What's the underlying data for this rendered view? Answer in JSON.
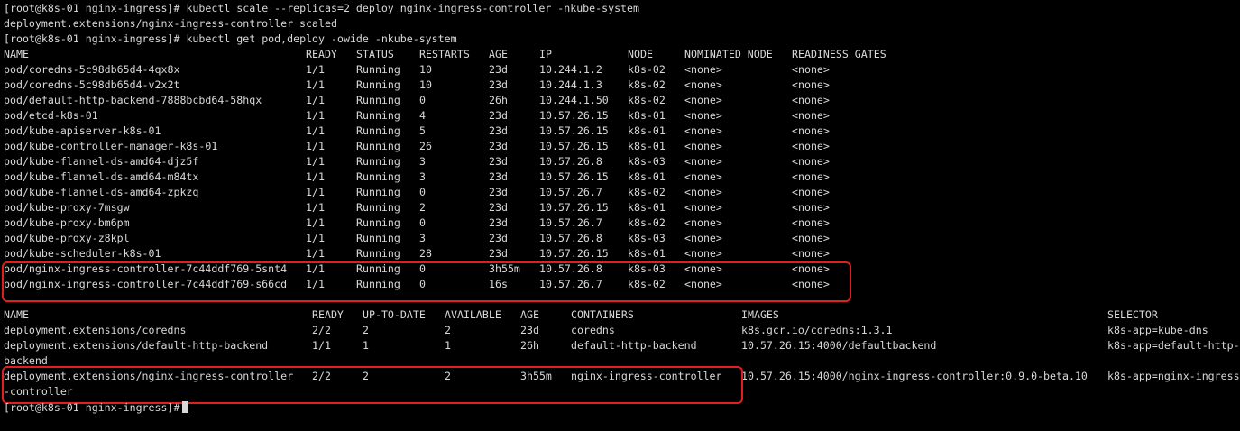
{
  "terminal": {
    "prompt": "[root@k8s-01 nginx-ingress]#",
    "cmd1": "kubectl scale --replicas=2 deploy nginx-ingress-controller -nkube-system",
    "scale_output": "deployment.extensions/nginx-ingress-controller scaled",
    "cmd2": "kubectl get pod,deploy -owide -nkube-system",
    "highlight_color": "#e02020"
  },
  "pods": {
    "headers": [
      "NAME",
      "READY",
      "STATUS",
      "RESTARTS",
      "AGE",
      "IP",
      "NODE",
      "NOMINATED NODE",
      "READINESS GATES"
    ],
    "rows": [
      [
        "pod/coredns-5c98db65d4-4qx8x",
        "1/1",
        "Running",
        "10",
        "23d",
        "10.244.1.2",
        "k8s-02",
        "<none>",
        "<none>"
      ],
      [
        "pod/coredns-5c98db65d4-v2x2t",
        "1/1",
        "Running",
        "10",
        "23d",
        "10.244.1.3",
        "k8s-02",
        "<none>",
        "<none>"
      ],
      [
        "pod/default-http-backend-7888bcbd64-58hqx",
        "1/1",
        "Running",
        "0",
        "26h",
        "10.244.1.50",
        "k8s-02",
        "<none>",
        "<none>"
      ],
      [
        "pod/etcd-k8s-01",
        "1/1",
        "Running",
        "4",
        "23d",
        "10.57.26.15",
        "k8s-01",
        "<none>",
        "<none>"
      ],
      [
        "pod/kube-apiserver-k8s-01",
        "1/1",
        "Running",
        "5",
        "23d",
        "10.57.26.15",
        "k8s-01",
        "<none>",
        "<none>"
      ],
      [
        "pod/kube-controller-manager-k8s-01",
        "1/1",
        "Running",
        "26",
        "23d",
        "10.57.26.15",
        "k8s-01",
        "<none>",
        "<none>"
      ],
      [
        "pod/kube-flannel-ds-amd64-djz5f",
        "1/1",
        "Running",
        "3",
        "23d",
        "10.57.26.8",
        "k8s-03",
        "<none>",
        "<none>"
      ],
      [
        "pod/kube-flannel-ds-amd64-m84tx",
        "1/1",
        "Running",
        "3",
        "23d",
        "10.57.26.15",
        "k8s-01",
        "<none>",
        "<none>"
      ],
      [
        "pod/kube-flannel-ds-amd64-zpkzq",
        "1/1",
        "Running",
        "0",
        "23d",
        "10.57.26.7",
        "k8s-02",
        "<none>",
        "<none>"
      ],
      [
        "pod/kube-proxy-7msgw",
        "1/1",
        "Running",
        "2",
        "23d",
        "10.57.26.15",
        "k8s-01",
        "<none>",
        "<none>"
      ],
      [
        "pod/kube-proxy-bm6pm",
        "1/1",
        "Running",
        "0",
        "23d",
        "10.57.26.7",
        "k8s-02",
        "<none>",
        "<none>"
      ],
      [
        "pod/kube-proxy-z8kpl",
        "1/1",
        "Running",
        "3",
        "23d",
        "10.57.26.8",
        "k8s-03",
        "<none>",
        "<none>"
      ],
      [
        "pod/kube-scheduler-k8s-01",
        "1/1",
        "Running",
        "28",
        "23d",
        "10.57.26.15",
        "k8s-01",
        "<none>",
        "<none>"
      ],
      [
        "pod/nginx-ingress-controller-7c44ddf769-5snt4",
        "1/1",
        "Running",
        "0",
        "3h55m",
        "10.57.26.8",
        "k8s-03",
        "<none>",
        "<none>"
      ],
      [
        "pod/nginx-ingress-controller-7c44ddf769-s66cd",
        "1/1",
        "Running",
        "0",
        "16s",
        "10.57.26.7",
        "k8s-02",
        "<none>",
        "<none>"
      ]
    ]
  },
  "deployments": {
    "headers": [
      "NAME",
      "READY",
      "UP-TO-DATE",
      "AVAILABLE",
      "AGE",
      "CONTAINERS",
      "IMAGES",
      "SELECTOR"
    ],
    "rows": [
      [
        "deployment.extensions/coredns",
        "2/2",
        "2",
        "2",
        "23d",
        "coredns",
        "k8s.gcr.io/coredns:1.3.1",
        "k8s-app=kube-dns"
      ],
      [
        "deployment.extensions/default-http-backend",
        "1/1",
        "1",
        "1",
        "26h",
        "default-http-backend",
        "10.57.26.15:4000/defaultbackend",
        "k8s-app=default-http-"
      ],
      [
        "deployment.extensions/nginx-ingress-controller",
        "2/2",
        "2",
        "2",
        "3h55m",
        "nginx-ingress-controller",
        "10.57.26.15:4000/nginx-ingress-controller:0.9.0-beta.10",
        "k8s-app=nginx-ingress"
      ]
    ],
    "wrap_lines": [
      "backend",
      "-controller"
    ]
  }
}
